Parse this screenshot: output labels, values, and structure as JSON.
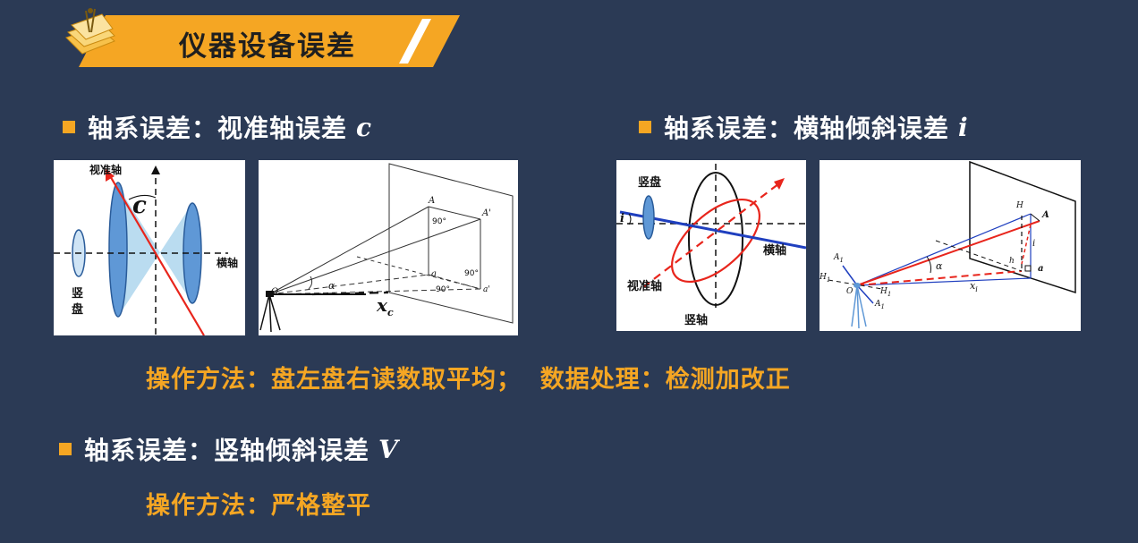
{
  "slide": {
    "title": "仪器设备误差"
  },
  "sections": {
    "collimation": {
      "heading": "轴系误差：视准轴误差",
      "symbol": "c"
    },
    "horizontal_axis": {
      "heading": "轴系误差：横轴倾斜误差",
      "symbol": "i"
    },
    "vertical_axis": {
      "heading": "轴系误差：竖轴倾斜误差",
      "symbol": "V"
    }
  },
  "method_line": {
    "text": "操作方法：盘左盘右读数取平均；  数据处理：检测加改正"
  },
  "method_line_2": {
    "text": "操作方法：严格整平"
  },
  "figure1": {
    "sight_axis": "视准轴",
    "symbol_c": "c",
    "vertical_circle": "竖\n盘",
    "vertical_circle_1": "竖",
    "vertical_circle_2": "盘",
    "horizontal_axis": "横轴"
  },
  "figure2": {
    "A": "A",
    "A_prime": "A'",
    "a": "a",
    "a_prime": "a'",
    "O": "O",
    "alpha": "α",
    "angle1": "90°",
    "angle2": "90°",
    "angle3": "90°",
    "xc": "x",
    "xc_sub": "c"
  },
  "figure3": {
    "vertical_circle": "竖盘",
    "i": "i",
    "horizontal_axis": "横轴",
    "sight_axis": "视准轴",
    "vertical_axis": "竖轴"
  },
  "figure4": {
    "H": "H",
    "A": "A",
    "A1": "A",
    "A1_sub": "1",
    "H1": "H",
    "H1_sub": "1",
    "H1b": "H",
    "H1b_sub": "1",
    "A1b": "A",
    "A1b_sub": "1",
    "O": "O",
    "alpha": "α",
    "i": "i",
    "h": "h",
    "a": "a",
    "xi": "x",
    "xi_sub": "i"
  },
  "colors": {
    "background": "#2b3a55",
    "accent": "#f5a623",
    "red_line": "#e8251c",
    "blue_line": "#1f3fbf"
  }
}
